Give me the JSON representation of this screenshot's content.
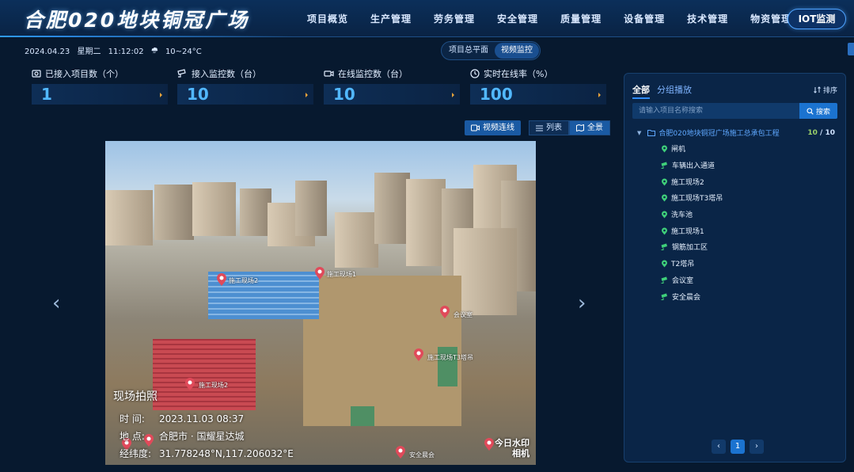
{
  "header": {
    "title": "合肥020地块铜冠广场",
    "nav": [
      "项目概览",
      "生产管理",
      "劳务管理",
      "安全管理",
      "质量管理",
      "设备管理",
      "技术管理",
      "物资管理"
    ],
    "iot_button": "IOT监测"
  },
  "subbar": {
    "date": "2024.04.23",
    "weekday": "星期二",
    "time": "11:12:02",
    "weather_icon": "cloud-rain-icon",
    "temperature": "10~24°C",
    "view_tabs": [
      {
        "label": "项目总平面",
        "active": false
      },
      {
        "label": "视频监控",
        "active": true
      }
    ]
  },
  "stats": [
    {
      "icon": "camera-icon",
      "label": "已接入项目数（个）",
      "value": "1"
    },
    {
      "icon": "cctv-icon",
      "label": "接入监控数（台）",
      "value": "10"
    },
    {
      "icon": "video-icon",
      "label": "在线监控数（台）",
      "value": "10"
    },
    {
      "icon": "clock-icon",
      "label": "实时在线率（%）",
      "value": "100"
    }
  ],
  "toolbar": {
    "connect_label": "视频连线",
    "list_label": "列表",
    "panorama_label": "全景"
  },
  "video": {
    "overlay_title": "现场拍照",
    "time_key": "时  间:",
    "time_value": "2023.11.03 08:37",
    "location_key": "地  点:",
    "location_value": "合肥市 · 国耀星达城",
    "coord_key": "经纬度:",
    "coord_value": "31.778248°N,117.206032°E",
    "watermark_line1": "今日水印",
    "watermark_line2": "相机",
    "markers": [
      "施工现场2",
      "施工现场1",
      "施工现场T3塔吊",
      "会议室",
      "安全晨会",
      "车辆出入通道",
      "洗车池",
      "钢筋加工区",
      "T2塔吊"
    ]
  },
  "panel": {
    "tabs": [
      {
        "label": "全部",
        "active": true
      },
      {
        "label": "分组播放",
        "active": false
      }
    ],
    "sort_label": "排序",
    "search_placeholder": "请输入项目名称搜索",
    "search_button": "搜索",
    "root_label": "合肥020地块铜冠广场施工总承包工程",
    "root_online": "10",
    "root_total": "/ 10",
    "items": [
      {
        "label": "闸机",
        "icon": "map-pin-icon"
      },
      {
        "label": "车辆出入通道",
        "icon": "cctv-icon"
      },
      {
        "label": "施工现场2",
        "icon": "map-pin-icon"
      },
      {
        "label": "施工现场T3塔吊",
        "icon": "map-pin-icon"
      },
      {
        "label": "洗车池",
        "icon": "map-pin-icon"
      },
      {
        "label": "施工现场1",
        "icon": "map-pin-icon"
      },
      {
        "label": "钢筋加工区",
        "icon": "cctv-icon"
      },
      {
        "label": "T2塔吊",
        "icon": "map-pin-icon"
      },
      {
        "label": "会议室",
        "icon": "cctv-icon"
      },
      {
        "label": "安全晨会",
        "icon": "cctv-icon"
      }
    ],
    "pagination": {
      "prev": "‹",
      "page": "1",
      "next": "›"
    }
  },
  "colors": {
    "background": "#07192f",
    "accent": "#1b73d0",
    "stat_value": "#52b8ff",
    "online_count": "#9bd06a",
    "tree_icon": "#3fd07a"
  }
}
